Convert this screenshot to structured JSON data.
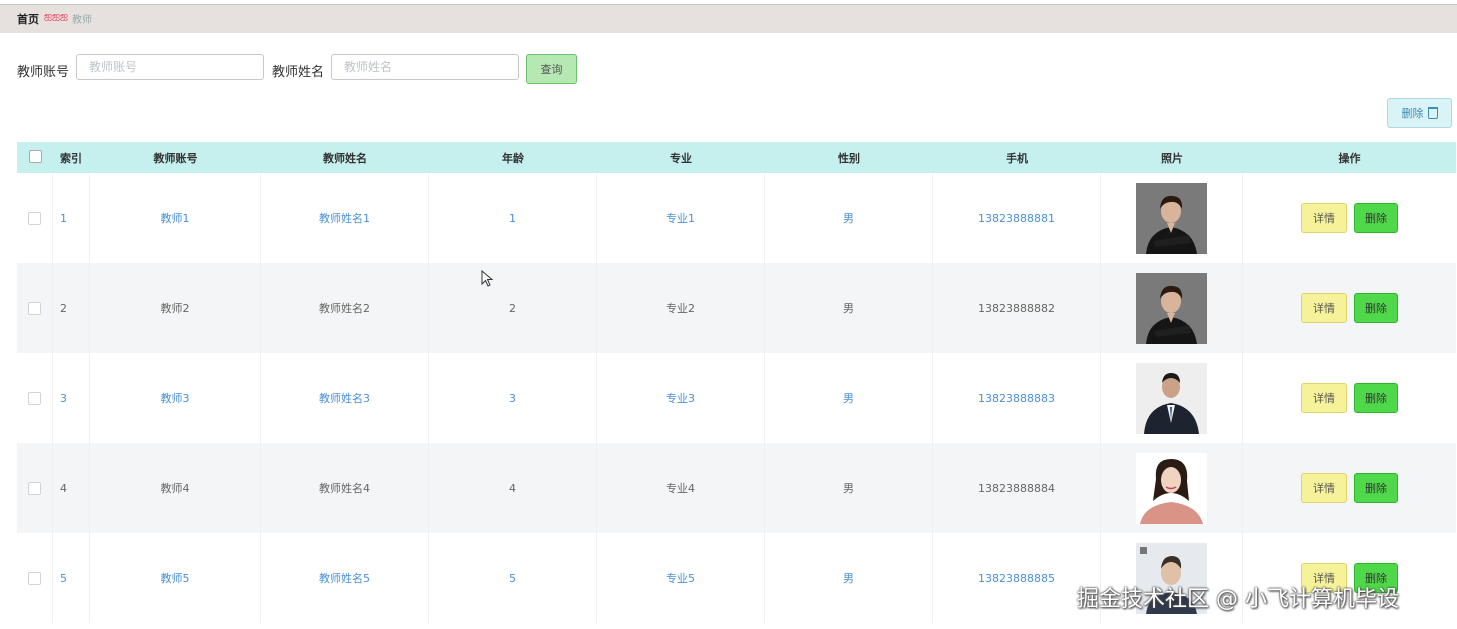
{
  "breadcrumb": {
    "home": "首页",
    "separator": "ஐஐஐ",
    "current": "教师"
  },
  "search": {
    "account_label": "教师账号",
    "account_placeholder": "教师账号",
    "name_label": "教师姓名",
    "name_placeholder": "教师姓名",
    "query_button": "查询"
  },
  "toolbar": {
    "delete_label": "删除"
  },
  "table": {
    "headers": [
      "索引",
      "教师账号",
      "教师姓名",
      "年龄",
      "专业",
      "性别",
      "手机",
      "照片",
      "操作"
    ],
    "rows": [
      {
        "index": "1",
        "account": "教师1",
        "name": "教师姓名1",
        "age": "1",
        "major": "专业1",
        "gender": "男",
        "phone": "13823888881",
        "photo": "photo-woman-black-suit"
      },
      {
        "index": "2",
        "account": "教师2",
        "name": "教师姓名2",
        "age": "2",
        "major": "专业2",
        "gender": "男",
        "phone": "13823888882",
        "photo": "photo-woman-black-suit"
      },
      {
        "index": "3",
        "account": "教师3",
        "name": "教师姓名3",
        "age": "3",
        "major": "专业3",
        "gender": "男",
        "phone": "13823888883",
        "photo": "photo-man-suit"
      },
      {
        "index": "4",
        "account": "教师4",
        "name": "教师姓名4",
        "age": "4",
        "major": "专业4",
        "gender": "男",
        "phone": "13823888884",
        "photo": "photo-woman-pink-blouse"
      },
      {
        "index": "5",
        "account": "教师5",
        "name": "教师姓名5",
        "age": "5",
        "major": "专业5",
        "gender": "男",
        "phone": "13823888885",
        "photo": "photo-man-portrait"
      }
    ],
    "detail_label": "详情",
    "row_delete_label": "删除"
  },
  "watermark": "掘金技术社区 @ 小飞计算机毕设",
  "colors": {
    "header_bg": "#c6f0ee",
    "link_blue": "#4a90d9",
    "detail_btn": "#f6f29a",
    "delete_btn": "#4fd84a",
    "query_btn": "#b6e8b4"
  }
}
